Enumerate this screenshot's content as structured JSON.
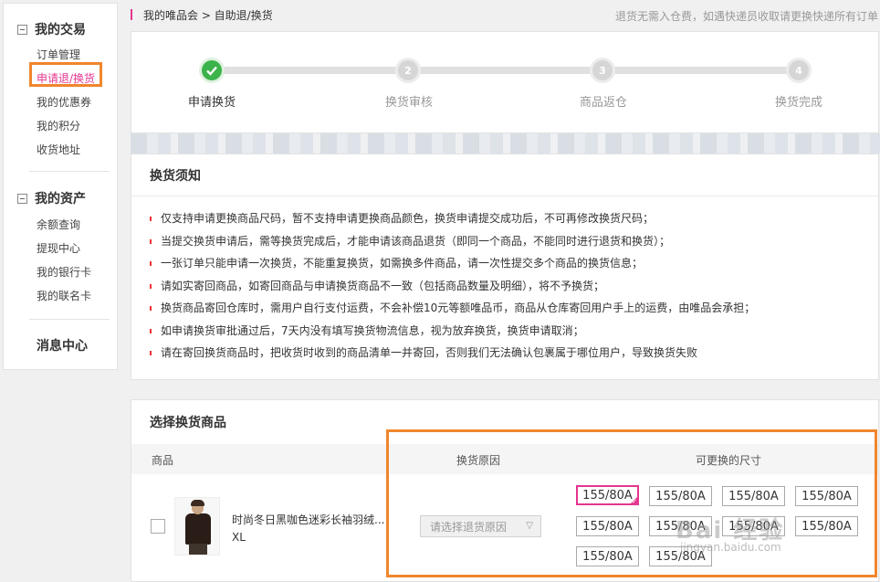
{
  "sidebar": {
    "groups": [
      {
        "title": "我的交易",
        "items": [
          "订单管理",
          "申请退/换货",
          "我的优惠券",
          "我的积分",
          "收货地址"
        ]
      },
      {
        "title": "我的资产",
        "items": [
          "余额查询",
          "提现中心",
          "我的银行卡",
          "我的联名卡"
        ]
      }
    ],
    "message_center": "消息中心",
    "active_item": "申请退/换货"
  },
  "breadcrumb": {
    "text": "我的唯品会 > 自助退/换货"
  },
  "notice": "退货无需入仓费，如遇快递员收取请更换快递所有订单",
  "steps": [
    {
      "label": "申请换货",
      "num": "",
      "status": "done"
    },
    {
      "label": "换货审核",
      "num": "2",
      "status": "pending"
    },
    {
      "label": "商品返仓",
      "num": "3",
      "status": "pending"
    },
    {
      "label": "换货完成",
      "num": "4",
      "status": "pending"
    }
  ],
  "rules": {
    "title": "换货须知",
    "items": [
      "仅支持申请更换商品尺码，暂不支持申请更换商品颜色，换货申请提交成功后，不可再修改换货尺码；",
      "当提交换货申请后，需等换货完成后，才能申请该商品退货（即同一个商品，不能同时进行退货和换货）；",
      "一张订单只能申请一次换货，不能重复换货，如需换多件商品，请一次性提交多个商品的换货信息；",
      "请如实寄回商品，如寄回商品与申请换货商品不一致（包括商品数量及明细），将不予换货；",
      "换货商品寄回仓库时，需用户自行支付运费，不会补偿10元等额唯品币，商品从仓库寄回用户手上的运费，由唯品会承担；",
      "如申请换货审批通过后，7天内没有填写换货物流信息，视为放弃换货，换货申请取消；",
      "请在寄回换货商品时，把收货时收到的商品清单一并寄回，否则我们无法确认包裹属于哪位用户，导致换货失败"
    ]
  },
  "goods": {
    "title": "选择换货商品",
    "columns": {
      "product": "商品",
      "reason": "换货原因",
      "sizes": "可更换的尺寸"
    },
    "row": {
      "name": "时尚冬日黑咖色迷彩长袖羽绒...",
      "size": "XL",
      "reason_placeholder": "请选择退货原因",
      "size_options": [
        "155/80A",
        "155/80A",
        "155/80A",
        "155/80A",
        "155/80A",
        "155/80A",
        "155/80A",
        "155/80A",
        "155/80A",
        "155/80A"
      ],
      "selected_index": 0
    }
  },
  "watermark": {
    "logo": "Bai 经验",
    "url": "jingyan.baidu.com"
  },
  "colors": {
    "accent": "#e4368f",
    "highlight": "#f0862d",
    "done": "#3cb34a"
  }
}
